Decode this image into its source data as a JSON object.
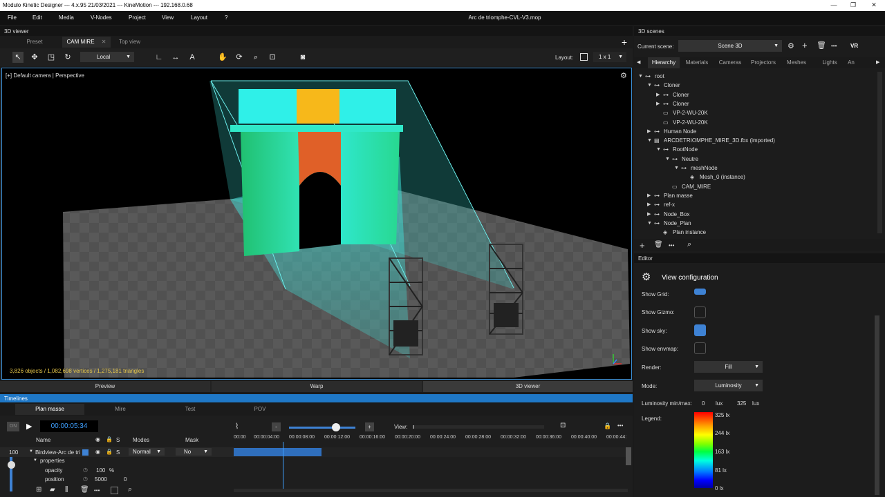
{
  "titlebar": {
    "title": "Modulo Kinetic Designer --- 4.x.95 21/03/2021 --- KineMotion --- 192.168.0.68",
    "minimize": "—",
    "maximize": "❐",
    "close": "✕"
  },
  "menu": {
    "items": [
      "File",
      "Edit",
      "Media",
      "V-Nodes",
      "Project",
      "View",
      "Layout",
      "?"
    ],
    "doc_title": "Arc de triomphe-CVL-V3.mop"
  },
  "viewer": {
    "header": "3D viewer",
    "tabs": [
      "Preset",
      "CAM MIRE",
      "Top view"
    ],
    "tab_close": "✕",
    "add": "+",
    "space": "Local",
    "layout_label": "Layout:",
    "layout_value": "1 x 1",
    "camera_label": "[+] Default camera | Perspective",
    "stats": "3,826 objects / 1,082,698 vertices / 1,275,181 triangles"
  },
  "bottom_tabs": [
    "Preview",
    "Warp",
    "3D viewer"
  ],
  "timelines": {
    "header": "Timelines",
    "tabs": [
      "Plan masse",
      "Mire",
      "Test",
      "POV"
    ],
    "on": "ON",
    "time": "00:00:05:34",
    "col_name": "Name",
    "col_s": "S",
    "col_modes": "Modes",
    "col_mask": "Mask",
    "view_label": "View:",
    "minus": "-",
    "plus": "+",
    "ticks": [
      "00:00",
      "00:00:04:00",
      "00:00:08:00",
      "00:00:12:00",
      "00:00:16:00",
      "00:00:20:00",
      "00:00:24:00",
      "00:00:28:00",
      "00:00:32:00",
      "00:00:36:00",
      "00:00:40:00",
      "00:00:44:"
    ],
    "layer_value": "100",
    "layer_name": "Birdview-Arc de tri",
    "layer_s": "S",
    "layer_mode": "Normal",
    "layer_mask": "No",
    "properties": "properties",
    "opacity_label": "opacity",
    "opacity_value": "100",
    "opacity_unit": "%",
    "position_label": "position",
    "position_x": "5000",
    "position_y": "0",
    "more": "•••"
  },
  "scenes": {
    "header": "3D scenes",
    "current_label": "Current scene:",
    "current_value": "Scene 3D",
    "vr": "VR",
    "more": "•••",
    "tabs": [
      "Hierarchy",
      "Materials",
      "Cameras",
      "Projectors",
      "Meshes",
      "Lights",
      "An"
    ],
    "tree": [
      {
        "label": "root",
        "depth": 0,
        "exp": "▼",
        "icon": "⊶"
      },
      {
        "label": "Cloner",
        "depth": 1,
        "exp": "▼",
        "icon": "⊶"
      },
      {
        "label": "Cloner",
        "depth": 2,
        "exp": "▶",
        "icon": "⊶"
      },
      {
        "label": "Cloner",
        "depth": 2,
        "exp": "▶",
        "icon": "⊶"
      },
      {
        "label": "VP-2-WU-20K",
        "depth": 2,
        "exp": "",
        "icon": "▭"
      },
      {
        "label": "VP-2-WU-20K",
        "depth": 2,
        "exp": "",
        "icon": "▭"
      },
      {
        "label": "Human Node",
        "depth": 1,
        "exp": "▶",
        "icon": "⊶"
      },
      {
        "label": "ARCDETRIOMPHE_MIRE_3D.fbx (imported)",
        "depth": 1,
        "exp": "▼",
        "icon": "▤"
      },
      {
        "label": "RootNode",
        "depth": 2,
        "exp": "▼",
        "icon": "⊶"
      },
      {
        "label": "Neutre",
        "depth": 3,
        "exp": "▼",
        "icon": "⊶"
      },
      {
        "label": "meshNode",
        "depth": 4,
        "exp": "▼",
        "icon": "⊶"
      },
      {
        "label": "Mesh_0 (instance)",
        "depth": 5,
        "exp": "",
        "icon": "◈"
      },
      {
        "label": "CAM_MIRE",
        "depth": 3,
        "exp": "",
        "icon": "▭"
      },
      {
        "label": "Plan masse",
        "depth": 1,
        "exp": "▶",
        "icon": "⊶"
      },
      {
        "label": "ref-x",
        "depth": 1,
        "exp": "▶",
        "icon": "⊶"
      },
      {
        "label": "Node_Box",
        "depth": 1,
        "exp": "▶",
        "icon": "⊶"
      },
      {
        "label": "Node_Plan",
        "depth": 1,
        "exp": "▼",
        "icon": "⊶"
      },
      {
        "label": "Plan instance",
        "depth": 2,
        "exp": "",
        "icon": "◈"
      }
    ]
  },
  "editor": {
    "header": "Editor",
    "title": "View configuration",
    "show_grid": "Show Grid:",
    "show_gizmo": "Show Gizmo:",
    "show_sky": "Show sky:",
    "show_envmap": "Show envmap:",
    "render_label": "Render:",
    "render_value": "Fill",
    "mode_label": "Mode:",
    "mode_value": "Luminosity",
    "lum_label": "Luminosity min/max:",
    "lum_min": "0",
    "lum_max": "325",
    "lux": "lux",
    "legend_label": "Legend:",
    "legend_ticks": [
      "325 lx",
      "244 lx",
      "163 lx",
      "81 lx",
      "0 lx"
    ]
  },
  "colors": {
    "accent": "#3e82d4",
    "timeline_header": "#1f78c7",
    "stats_text": "#e8c84a"
  }
}
